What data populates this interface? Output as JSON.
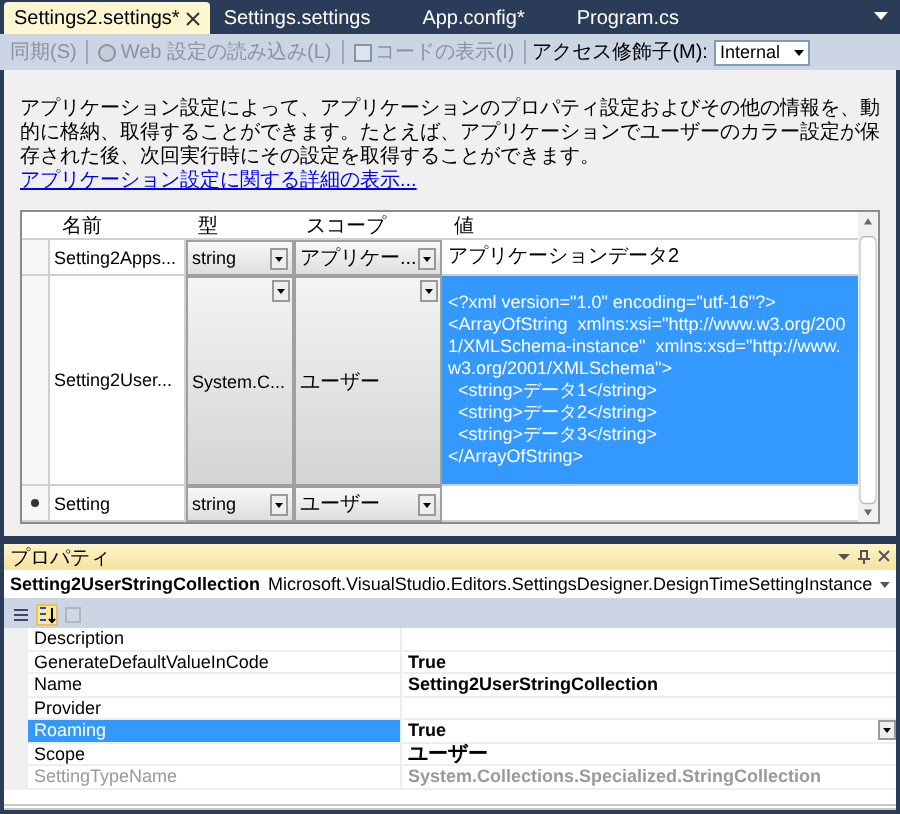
{
  "tabs": [
    {
      "label": "Settings2.settings*",
      "selected": true
    },
    {
      "label": "Settings.settings",
      "selected": false
    },
    {
      "label": "App.config*",
      "selected": false
    },
    {
      "label": "Program.cs",
      "selected": false
    }
  ],
  "toolbar": {
    "buttons": [
      {
        "label": "同期(S)",
        "kind": "text",
        "disabled": true
      },
      {
        "label": "Web 設定の読み込み(L)",
        "kind": "globe",
        "disabled": true
      },
      {
        "label": "コードの表示(I)",
        "kind": "code",
        "disabled": true
      }
    ],
    "access_label": "アクセス修飾子(M):",
    "access_value": "Internal"
  },
  "description": {
    "text": "アプリケーション設定によって、アプリケーションのプロパティ設定およびその他の情報を、動的に格納、取得することができます。たとえば、アプリケーションでユーザーのカラー設定が保存された後、次回実行時にその設定を取得することができます。",
    "link": "アプリケーション設定に関する詳細の表示..."
  },
  "grid": {
    "columns": [
      "名前",
      "型",
      "スコープ",
      "値"
    ],
    "rows": [
      {
        "kind": "setting",
        "name": "Setting2Apps...",
        "type": "string",
        "scope": "アプリケー...",
        "value": "アプリケーションデータ2",
        "selected": false
      },
      {
        "kind": "setting",
        "name": "Setting2User...",
        "type": "System.C...",
        "scope": "ユーザー",
        "value": "<?xml version=\"1.0\" encoding=\"utf-16\"?>\n<ArrayOfString  xmlns:xsi=\"http://www.w3.org/2001/XMLSchema-instance\"  xmlns:xsd=\"http://www.w3.org/2001/XMLSchema\">\n  <string>データ1</string>\n  <string>データ2</string>\n  <string>データ3</string>\n</ArrayOfString>",
        "selected": true
      },
      {
        "kind": "new",
        "name": "Setting",
        "type": "string",
        "scope": "ユーザー",
        "value": "",
        "selected": false
      }
    ]
  },
  "properties": {
    "title": "プロパティ",
    "object_name": "Setting2UserStringCollection",
    "object_type": "Microsoft.VisualStudio.Editors.SettingsDesigner.DesignTimeSettingInstance",
    "tools": [
      {
        "kind": "categorized",
        "selected": false,
        "disabled": false
      },
      {
        "kind": "alphabetical",
        "selected": true,
        "disabled": false
      },
      {
        "kind": "pages",
        "selected": false,
        "disabled": true
      }
    ],
    "rows": [
      {
        "name": "Description",
        "value": "",
        "selected": false,
        "readonly": false
      },
      {
        "name": "GenerateDefaultValueInCode",
        "value": "True",
        "selected": false,
        "readonly": false
      },
      {
        "name": "Name",
        "value": "Setting2UserStringCollection",
        "selected": false,
        "readonly": false
      },
      {
        "name": "Provider",
        "value": "",
        "selected": false,
        "readonly": false
      },
      {
        "name": "Roaming",
        "value": "True",
        "selected": true,
        "readonly": false
      },
      {
        "name": "Scope",
        "value": "ユーザー",
        "selected": false,
        "readonly": false
      },
      {
        "name": "SettingTypeName",
        "value": "System.Collections.Specialized.StringCollection",
        "selected": false,
        "readonly": true
      }
    ]
  }
}
